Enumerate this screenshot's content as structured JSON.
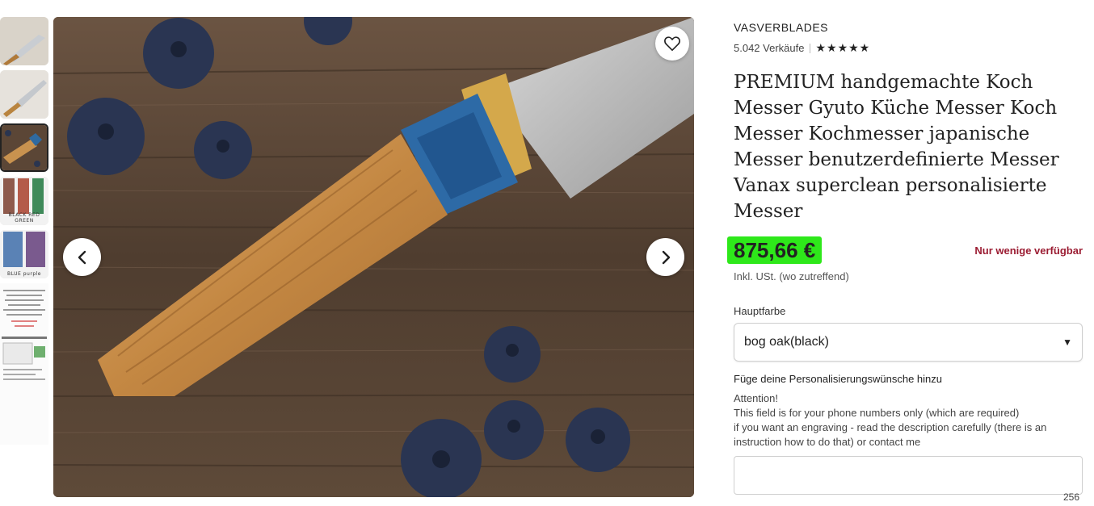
{
  "thumbnails": [
    {
      "caption": ""
    },
    {
      "caption": ""
    },
    {
      "caption": ""
    },
    {
      "caption": "BLACK  RED  GREEN"
    },
    {
      "caption": "BLUE   purple"
    },
    {
      "caption": ""
    }
  ],
  "icons": {
    "favorite": "heart-icon",
    "prev": "chevron-left-icon",
    "next": "chevron-right-icon",
    "rating": "star-icon",
    "dropdown": "caret-down-icon"
  },
  "shop": {
    "name": "VASVERBLADES",
    "sales": "5.042 Verkäufe",
    "stars": "★★★★★"
  },
  "product": {
    "title": "PREMIUM handgemachte Koch Messer Gyuto Küche Messer Koch Messer Kochmesser japanische Messer benutzerdefinierte Messer Vanax superclean personalisierte Messer",
    "price": "875,66 €",
    "stock_note": "Nur wenige verfügbar",
    "tax_note": "Inkl. USt. (wo zutreffend)"
  },
  "variant": {
    "label": "Hauptfarbe",
    "selected": "bog oak(black)"
  },
  "personalization": {
    "label": "Füge deine Personalisierungswünsche hinzu",
    "line1": "Attention!",
    "line2": "This field is for your phone numbers only (which are required)",
    "line3": "if you want an engraving - read the description carefully (there is an instruction how to do that) or contact me",
    "value": "",
    "char_limit": "256"
  },
  "colors": {
    "price_highlight": "#2ee81a",
    "stock_note": "#9b1c32"
  }
}
